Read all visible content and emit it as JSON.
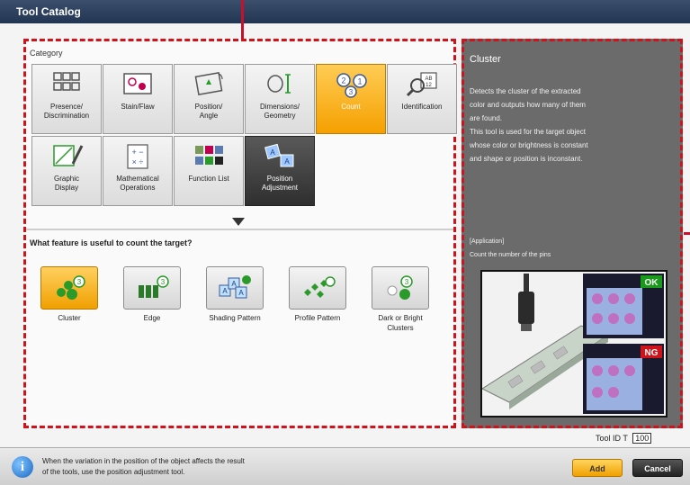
{
  "window": {
    "title": "Tool Catalog"
  },
  "category": {
    "header": "Category",
    "tiles": [
      {
        "label1": "Presence/",
        "label2": "Discrimination",
        "icon": "grid-squares-icon",
        "state": "normal"
      },
      {
        "label1": "Stain/Flaw",
        "label2": "",
        "icon": "stain-flaw-icon",
        "state": "normal"
      },
      {
        "label1": "Position/",
        "label2": "Angle",
        "icon": "position-angle-icon",
        "state": "normal"
      },
      {
        "label1": "Dimensions/",
        "label2": "Geometry",
        "icon": "dimensions-icon",
        "state": "normal"
      },
      {
        "label1": "Count",
        "label2": "",
        "icon": "count-circles-icon",
        "state": "selected"
      },
      {
        "label1": "Identification",
        "label2": "",
        "icon": "identification-icon",
        "state": "normal"
      },
      {
        "label1": "Graphic",
        "label2": "Display",
        "icon": "graphic-display-icon",
        "state": "normal"
      },
      {
        "label1": "Mathematical",
        "label2": "Operations",
        "icon": "math-operations-icon",
        "state": "normal"
      },
      {
        "label1": "Function List",
        "label2": "",
        "icon": "function-list-icon",
        "state": "normal"
      },
      {
        "label1": "Position",
        "label2": "Adjustment",
        "icon": "position-adjustment-icon",
        "state": "dark"
      }
    ]
  },
  "feature": {
    "question": "What feature is useful to count the target?",
    "options": [
      {
        "label1": "Cluster",
        "label2": "",
        "icon": "cluster-icon",
        "state": "selected"
      },
      {
        "label1": "Edge",
        "label2": "",
        "icon": "edge-icon",
        "state": "normal"
      },
      {
        "label1": "Shading Pattern",
        "label2": "",
        "icon": "shading-pattern-icon",
        "state": "normal"
      },
      {
        "label1": "Profile Pattern",
        "label2": "",
        "icon": "profile-pattern-icon",
        "state": "normal"
      },
      {
        "label1": "Dark or Bright",
        "label2": "Clusters",
        "icon": "dark-bright-clusters-icon",
        "state": "normal"
      }
    ]
  },
  "details": {
    "title": "Cluster",
    "description_lines": [
      "Detects the cluster of the extracted",
      "color and outputs how many of them",
      "are found.",
      "This tool is used for the target object",
      "whose color or brightness is constant",
      "and shape or position is inconstant."
    ],
    "application_header": "[Application]",
    "application_text": "Count the number of the pins",
    "ok_label": "OK",
    "ng_label": "NG"
  },
  "tool_id": {
    "label": "Tool ID",
    "prefix": "T",
    "value": "100"
  },
  "bottom": {
    "hint_line1": "When the variation in the position of the object affects the result",
    "hint_line2": "of the tools, use the position adjustment tool.",
    "add_label": "Add",
    "cancel_label": "Cancel"
  },
  "colors": {
    "accent": "#f5a000",
    "dashed_border": "#d0121b",
    "titlebar": "#2a3d5c"
  }
}
